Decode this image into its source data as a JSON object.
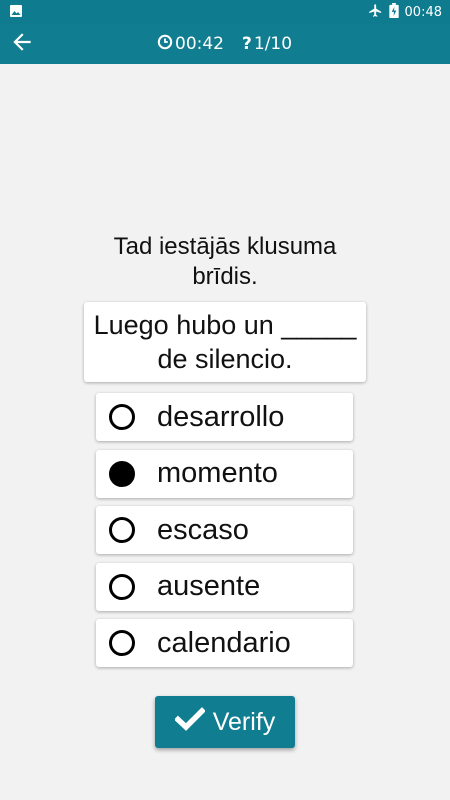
{
  "status_bar": {
    "time": "00:48",
    "icons": [
      "image-icon",
      "airplane-icon",
      "battery-charging-icon"
    ]
  },
  "app_bar": {
    "back_icon": "arrow-left-icon",
    "timer_icon": "clock-icon",
    "timer": "00:42",
    "progress_icon": "question-icon",
    "progress": "1/10"
  },
  "question": {
    "source_text": "Tad iestājās klusuma brīdis.",
    "sentence": "Luego hubo un _____ de silencio."
  },
  "options": [
    {
      "label": "desarrollo",
      "selected": false
    },
    {
      "label": "momento",
      "selected": true
    },
    {
      "label": "escaso",
      "selected": false
    },
    {
      "label": "ausente",
      "selected": false
    },
    {
      "label": "calendario",
      "selected": false
    }
  ],
  "verify": {
    "label": "Verify",
    "icon": "checkmark-icon"
  },
  "colors": {
    "primary": "#117d90",
    "background": "#f2f2f2"
  }
}
